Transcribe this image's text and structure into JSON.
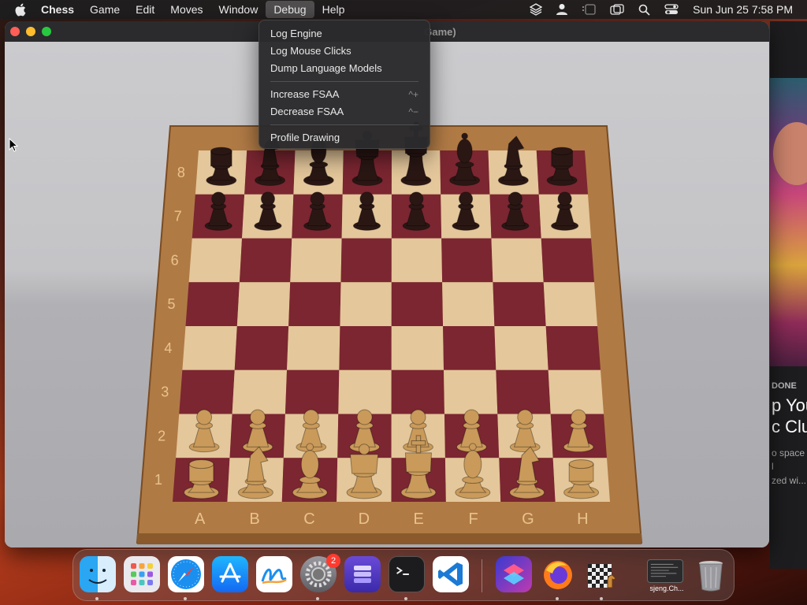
{
  "menubar": {
    "app": "Chess",
    "items": [
      "Game",
      "Edit",
      "Moves",
      "Window",
      "Debug",
      "Help"
    ],
    "active": "Debug",
    "clock": "Sun Jun 25  7:58 PM"
  },
  "window": {
    "title": "Game)"
  },
  "debug_menu": {
    "items": [
      {
        "label": "Log Engine",
        "shortcut": ""
      },
      {
        "label": "Log Mouse Clicks",
        "shortcut": ""
      },
      {
        "label": "Dump Language Models",
        "shortcut": ""
      },
      {
        "label": "Increase FSAA",
        "shortcut": "^+"
      },
      {
        "label": "Decrease FSAA",
        "shortcut": "^−"
      },
      {
        "label": "Profile Drawing",
        "shortcut": ""
      }
    ]
  },
  "board": {
    "ranks": [
      "8",
      "7",
      "6",
      "5",
      "4",
      "3",
      "2",
      "1"
    ],
    "files": [
      "A",
      "B",
      "C",
      "D",
      "E",
      "F",
      "G",
      "H"
    ],
    "colors": {
      "dark": "#7b2631",
      "light": "#e4c79b",
      "frame": "#b07a45",
      "black_piece": "#2a1714",
      "white_piece": "#c99a5a"
    }
  },
  "side_window": {
    "label": "DONE",
    "lines": [
      "p You",
      "c Clut"
    ],
    "sub": [
      "o space",
      "l",
      "zed wi..."
    ]
  },
  "dock": {
    "badge": "2",
    "terminal_label": "sjeng.Ch..."
  }
}
